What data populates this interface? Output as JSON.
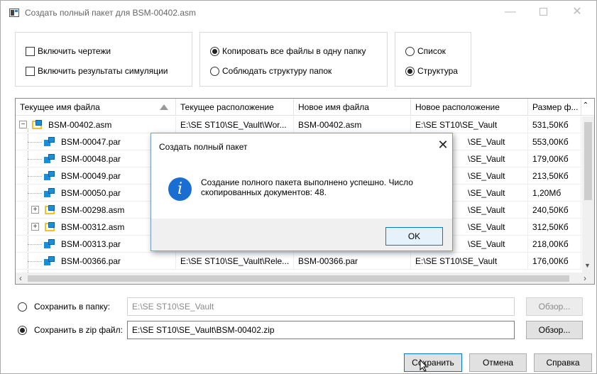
{
  "window": {
    "title": "Создать полный пакет для BSM-00402.asm",
    "min_glyph": "—",
    "close_glyph": "✕"
  },
  "options": {
    "include_drawings": "Включить чертежи",
    "include_sim": "Включить результаты симуляции",
    "copy_all_one_folder": "Копировать все файлы в одну папку",
    "keep_structure": "Соблюдать структуру папок",
    "view_list": "Список",
    "view_structure": "Структура"
  },
  "table": {
    "headers": [
      "Текущее имя файла",
      "Текущее расположение",
      "Новое имя файла",
      "Новое расположение",
      "Размер ф..."
    ],
    "rows": [
      {
        "name": "BSM-00402.asm",
        "cur_loc": "E:\\SE ST10\\SE_Vault\\Wor...",
        "new_name": "BSM-00402.asm",
        "new_loc": "E:\\SE ST10\\SE_Vault",
        "size": "531,50Кб"
      },
      {
        "name": "BSM-00047.par",
        "cur_loc": "",
        "new_name": "",
        "new_loc": "\\SE_Vault",
        "size": "553,00Кб"
      },
      {
        "name": "BSM-00048.par",
        "cur_loc": "",
        "new_name": "",
        "new_loc": "\\SE_Vault",
        "size": "179,00Кб"
      },
      {
        "name": "BSM-00049.par",
        "cur_loc": "",
        "new_name": "",
        "new_loc": "\\SE_Vault",
        "size": "213,50Кб"
      },
      {
        "name": "BSM-00050.par",
        "cur_loc": "",
        "new_name": "",
        "new_loc": "\\SE_Vault",
        "size": "1,20Мб"
      },
      {
        "name": "BSM-00298.asm",
        "cur_loc": "",
        "new_name": "",
        "new_loc": "\\SE_Vault",
        "size": "240,50Кб"
      },
      {
        "name": "BSM-00312.asm",
        "cur_loc": "",
        "new_name": "",
        "new_loc": "\\SE_Vault",
        "size": "312,50Кб"
      },
      {
        "name": "BSM-00313.par",
        "cur_loc": "",
        "new_name": "",
        "new_loc": "\\SE_Vault",
        "size": "218,00Кб"
      },
      {
        "name": "BSM-00366.par",
        "cur_loc": "E:\\SE ST10\\SE_Vault\\Rele...",
        "new_name": "BSM-00366.par",
        "new_loc": "E:\\SE ST10\\SE_Vault",
        "size": "176,00Кб"
      }
    ]
  },
  "save": {
    "to_folder_label": "Сохранить в папку:",
    "to_folder_value": "E:\\SE ST10\\SE_Vault",
    "to_zip_label": "Сохранить в zip файл:",
    "to_zip_value": "E:\\SE ST10\\SE_Vault\\BSM-00402.zip",
    "browse_label": "Обзор..."
  },
  "footer": {
    "save_label": "Сохранить",
    "cancel_label": "Отмена",
    "help_label": "Справка"
  },
  "message": {
    "title": "Создать полный пакет",
    "text": "Создание полного пакета выполнено успешно. Число скопированных документов: 48.",
    "ok_label": "OK",
    "close_glyph": "✕",
    "info_glyph": "i"
  }
}
